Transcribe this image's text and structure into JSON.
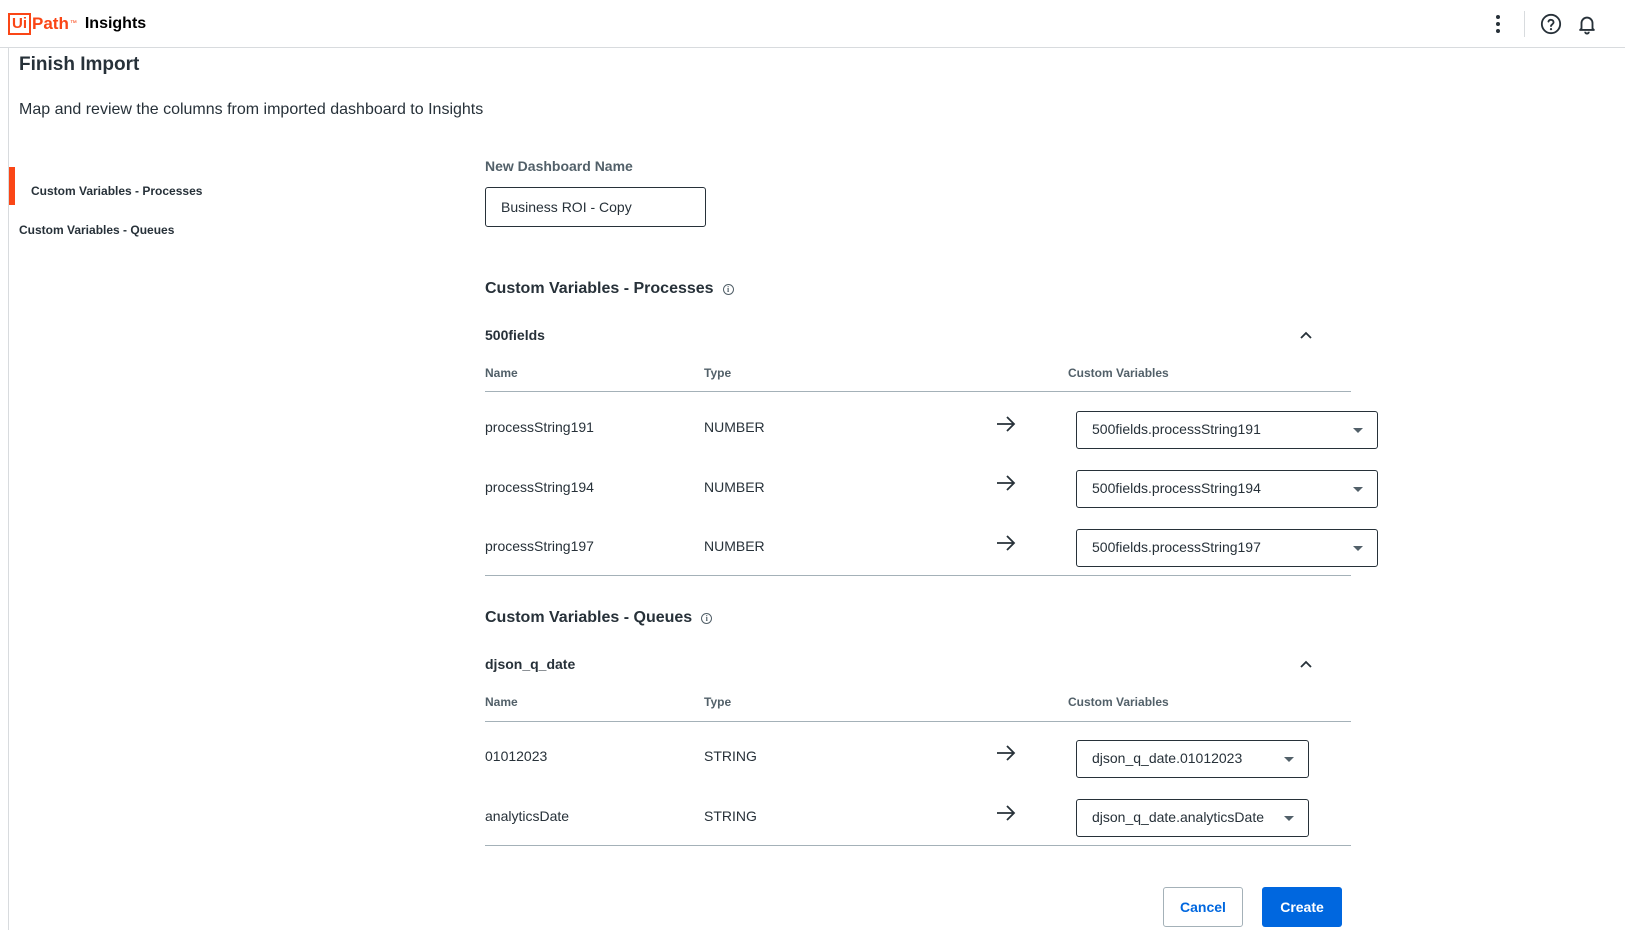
{
  "header": {
    "logo_ui": "Ui",
    "logo_path": "Path",
    "logo_tm": "™",
    "product": "Insights",
    "icons": [
      "more-vertical-icon",
      "help-icon",
      "bell-icon"
    ]
  },
  "page": {
    "title": "Finish Import",
    "subtitle": "Map and review the columns from imported dashboard to Insights"
  },
  "sidenav": {
    "items": [
      {
        "label": "Custom Variables - Processes",
        "active": true
      },
      {
        "label": "Custom Variables - Queues",
        "active": false
      }
    ],
    "accent": "#fa4616"
  },
  "form": {
    "name_label": "New Dashboard Name",
    "name_value": "Business ROI - Copy"
  },
  "sections": [
    {
      "title": "Custom Variables - Processes",
      "group": "500fields",
      "columns": [
        "Name",
        "Type",
        "Custom Variables"
      ],
      "rows": [
        {
          "name": "processString191",
          "type": "NUMBER",
          "mapped": "500fields.processString191"
        },
        {
          "name": "processString194",
          "type": "NUMBER",
          "mapped": "500fields.processString194"
        },
        {
          "name": "processString197",
          "type": "NUMBER",
          "mapped": "500fields.processString197"
        }
      ]
    },
    {
      "title": "Custom Variables - Queues",
      "group": "djson_q_date",
      "columns": [
        "Name",
        "Type",
        "Custom Variables"
      ],
      "rows": [
        {
          "name": "01012023",
          "type": "STRING",
          "mapped": "djson_q_date.01012023"
        },
        {
          "name": "analyticsDate",
          "type": "STRING",
          "mapped": "djson_q_date.analyticsDate"
        }
      ]
    }
  ],
  "actions": {
    "cancel": "Cancel",
    "create": "Create"
  },
  "colors": {
    "brand": "#fa4616",
    "primary": "#0067df",
    "text": "#273139"
  }
}
